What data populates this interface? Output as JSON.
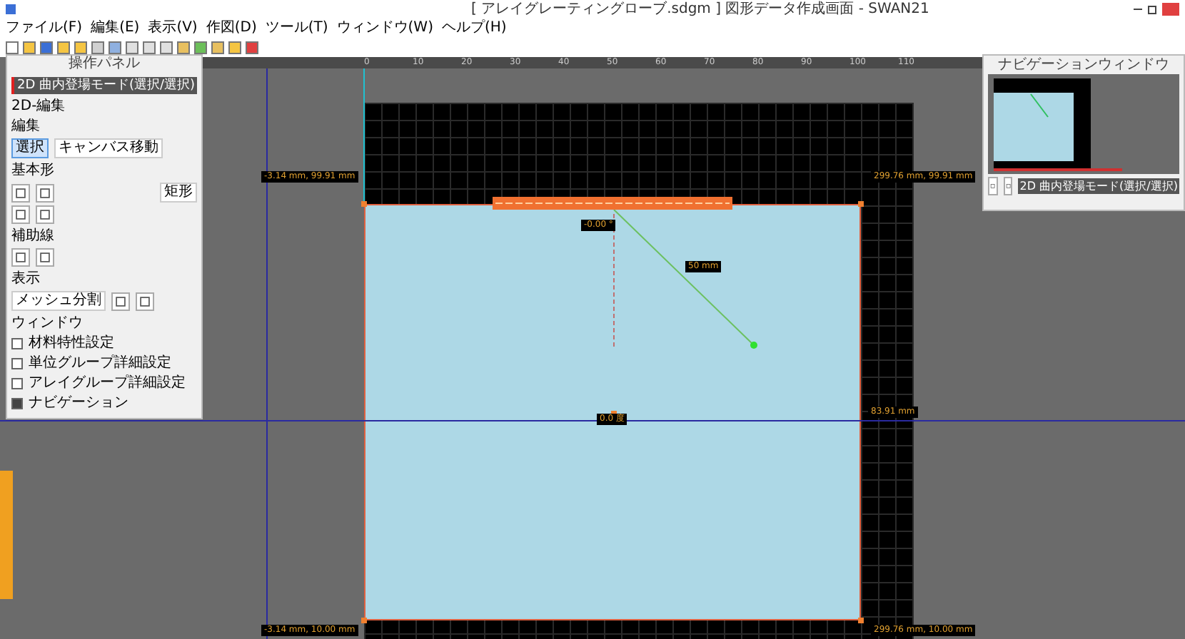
{
  "window": {
    "title": "[ アレイグレーティングローブ.sdgm ] 図形データ作成画面 - SWAN21"
  },
  "menu": [
    "ファイル(F)",
    "編集(E)",
    "表示(V)",
    "作図(D)",
    "ツール(T)",
    "ウィンドウ(W)",
    "ヘルプ(H)"
  ],
  "ruler": {
    "labels": [
      "0",
      "10",
      "20",
      "30",
      "40",
      "50",
      "60",
      "70",
      "80",
      "90",
      "100",
      "110"
    ]
  },
  "operation_panel": {
    "title": "操作パネル",
    "mode": "2D 曲内登場モード(選択/選択)",
    "edit": {
      "title": "2D-編集",
      "subtitle": "編集",
      "buttons": [
        {
          "label": "選択",
          "selected": true
        },
        {
          "label": "キャンバス移動",
          "selected": false
        }
      ]
    },
    "shapes": {
      "title": "基本形",
      "button": "矩形"
    },
    "guides": {
      "title": "補助線"
    },
    "display": {
      "title": "表示",
      "button": "メッシュ分割"
    },
    "windows": {
      "title": "ウィンドウ",
      "items": [
        {
          "label": "材料特性設定",
          "checked": false
        },
        {
          "label": "単位グループ詳細設定",
          "checked": false
        },
        {
          "label": "アレイグループ詳細設定",
          "checked": false
        },
        {
          "label": "ナビゲーション",
          "checked": true
        }
      ]
    }
  },
  "navigator": {
    "title": "ナビゲーションウィンドウ",
    "mode": "2D 曲内登場モード(選択/選択)"
  },
  "canvas": {
    "labels": [
      "-3.14 mm, 99.91 mm",
      "299.76 mm, 99.91 mm",
      "-0.00 °",
      "50 mm",
      "0.0 度",
      "83.91 mm",
      "-3.14 mm, 10.00 mm",
      "299.76 mm, 10.00 mm"
    ]
  }
}
